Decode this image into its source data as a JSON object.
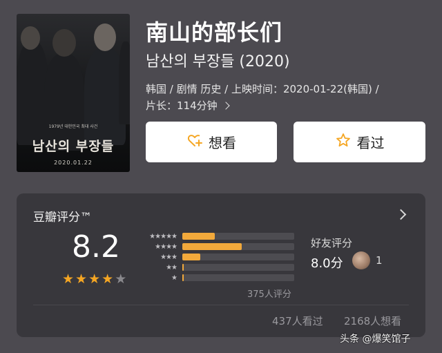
{
  "movie": {
    "title": "南山的部长们",
    "subtitle": "남산의 부장들 (2020)",
    "meta_line1": "韩国 / 剧情 历史 / 上映时间：2020-01-22(韩国) /",
    "meta_line2": "片长：114分钟"
  },
  "poster": {
    "tagline": "1979년 대한민국 최대 사건",
    "title": "남산의 부장들",
    "date": "2020.01.22"
  },
  "actions": {
    "want_label": "想看",
    "seen_label": "看过"
  },
  "rating": {
    "card_title": "豆瓣评分™",
    "score": "8.2",
    "stars_filled": 4,
    "stars_total": 5,
    "star_rows": [
      {
        "stars": 5,
        "fraction": 0.29
      },
      {
        "stars": 4,
        "fraction": 0.53
      },
      {
        "stars": 3,
        "fraction": 0.16
      },
      {
        "stars": 2,
        "fraction": 0.01
      },
      {
        "stars": 1,
        "fraction": 0.01
      }
    ],
    "rating_count": "375人评分",
    "friend_title": "好友评分",
    "friend_score": "8.0分",
    "friend_count": "1",
    "seen_count": "437人看过",
    "wish_count": "2168人想看"
  },
  "watermark": "头条 @爆笑馆子",
  "colors": {
    "accent": "#f5a623",
    "background": "#4c4a50",
    "card": "#38373c"
  }
}
